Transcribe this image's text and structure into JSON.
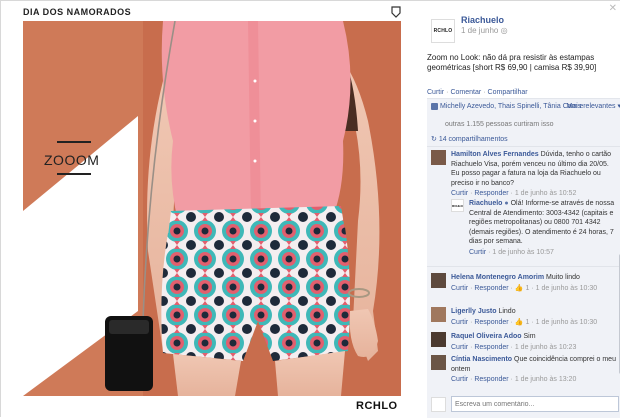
{
  "photo": {
    "caption_top": "DIA DOS NAMORADOS",
    "overlay_text": "ZOOOM",
    "brand_bottom": "RCHLO"
  },
  "post": {
    "page_logo": "RCHLO",
    "page_name": "Riachuelo",
    "date": "1 de junho",
    "text": "Zoom no Look: não dá pra resistir às estampas geométricas [short R$ 69,90 | camisa R$ 39,90]",
    "actions": [
      "Curtir",
      "Comentar",
      "Compartilhar"
    ]
  },
  "reactions": {
    "likers": "Michelly Azevedo, Thais Spinelli, Tânia Cam e",
    "more_label": "Mais relevantes",
    "people_like": "outras 1.155 pessoas curtiram isso",
    "shares": "14 compartilhamentos"
  },
  "comments": [
    {
      "name": "Hamilton Alves Fernandes",
      "text": "Dúvida, tenho o cartão Riachuelo Visa, porém venceu no último dia 20/05. Eu posso pagar a fatura na loja da Riachuelo ou preciso ir no banco?",
      "meta_actions": [
        "Curtir",
        "Responder"
      ],
      "time": "1 de junho às 10:52"
    },
    {
      "name": "Riachuelo",
      "text": "Olá! Informe-se através de nossa Central de Atendimento: 3003-4342 (capitais e regiões metropolitanas) ou 0800 701 4342 (demais regiões). O atendimento é 24 horas, 7 dias por semana.",
      "meta_actions": [
        "Curtir"
      ],
      "time": "1 de junho às 10:57",
      "is_reply": true
    },
    {
      "name": "Helena Montenegro Amorim",
      "text": "Muito lindo",
      "meta_actions": [
        "Curtir",
        "Responder"
      ],
      "likes": "1",
      "time": "1 de junho às 10:30"
    },
    {
      "name": "Ligerlly Justo",
      "text": "Lindo",
      "meta_actions": [
        "Curtir",
        "Responder"
      ],
      "likes": "1",
      "time": "1 de junho às 10:30"
    },
    {
      "name": "Raquel Oliveira Adoo",
      "text": "Sim",
      "meta_actions": [
        "Curtir",
        "Responder"
      ],
      "time": "1 de junho às 10:23"
    },
    {
      "name": "Cíntia Nascimento",
      "text": "Que coincidência comprei o meu ontem",
      "meta_actions": [
        "Curtir",
        "Responder"
      ],
      "time": "1 de junho às 13:20"
    }
  ],
  "write_comment": {
    "placeholder": "Escreva um comentário..."
  },
  "colors": {
    "link": "#3b5998",
    "panel_bg": "#f0f2f7",
    "photo_bg": "#c36a4a"
  }
}
